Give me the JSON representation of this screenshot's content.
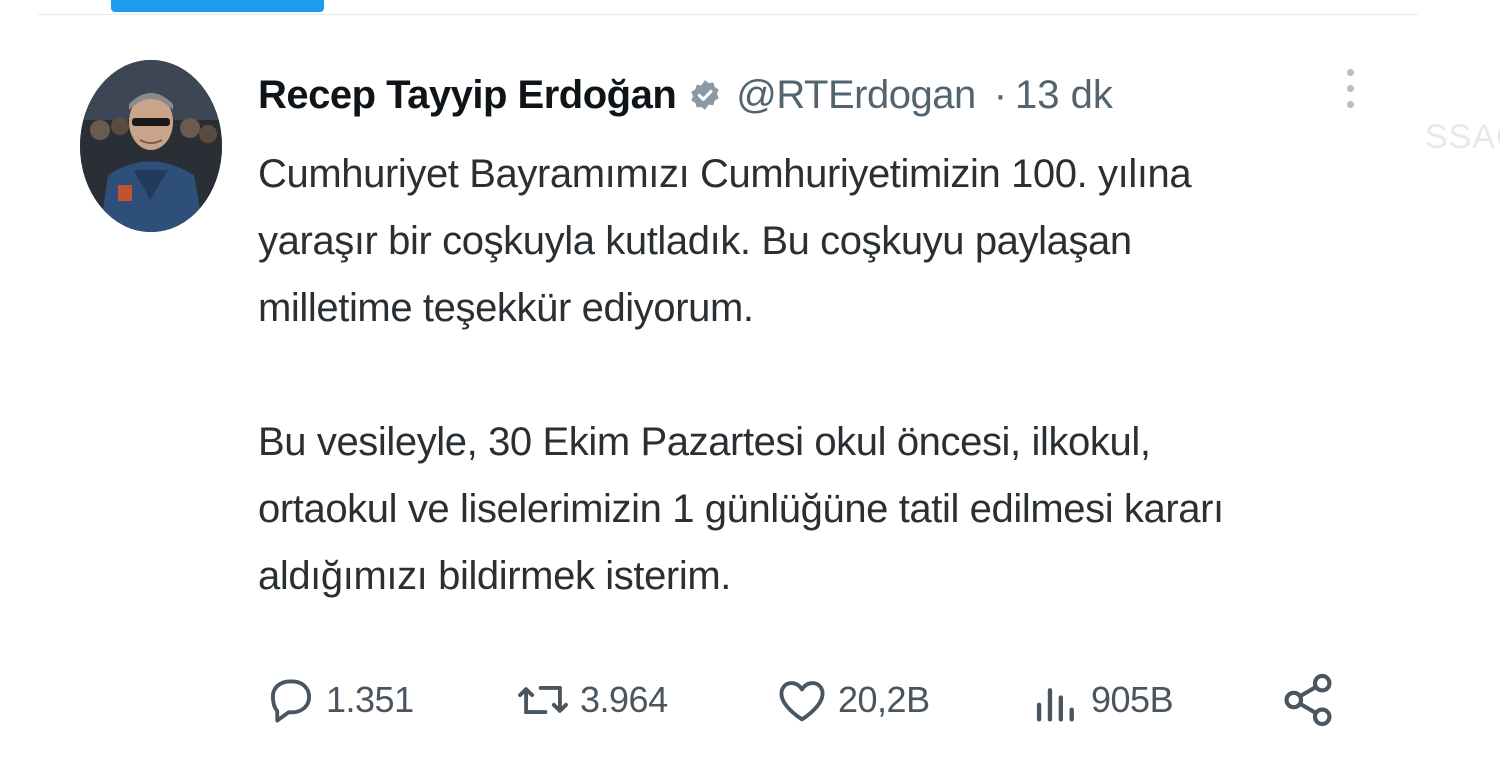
{
  "tweet": {
    "author": {
      "name": "Recep Tayyip Erdoğan",
      "handle": "@RTErdogan",
      "verified": true
    },
    "separator": "·",
    "time": "13 dk",
    "text": {
      "lines": [
        "Cumhuriyet Bayramımızı Cumhuriyetimizin 100. yılına",
        "yaraşır bir coşkuyla kutladık. Bu coşkuyu paylaşan",
        "milletime teşekkür ediyorum.",
        "",
        "Bu vesileyle, 30 Ekim Pazartesi okul öncesi, ilkokul,",
        "ortaokul ve liselerimizin 1 günlüğüne tatil edilmesi kararı",
        "aldığımızı bildirmek isterim."
      ]
    },
    "actions": {
      "reply": {
        "icon": "reply-icon",
        "count": "1.351"
      },
      "retweet": {
        "icon": "retweet-icon",
        "count": "3.964"
      },
      "like": {
        "icon": "heart-icon",
        "count": "20,2B"
      },
      "views": {
        "icon": "views-icon",
        "count": "905B"
      },
      "share": {
        "icon": "share-icon"
      }
    }
  },
  "side_text": "SSAG",
  "colors": {
    "accent": "#1d9bf0",
    "text_primary": "#0f1419",
    "text_secondary": "#536471"
  }
}
